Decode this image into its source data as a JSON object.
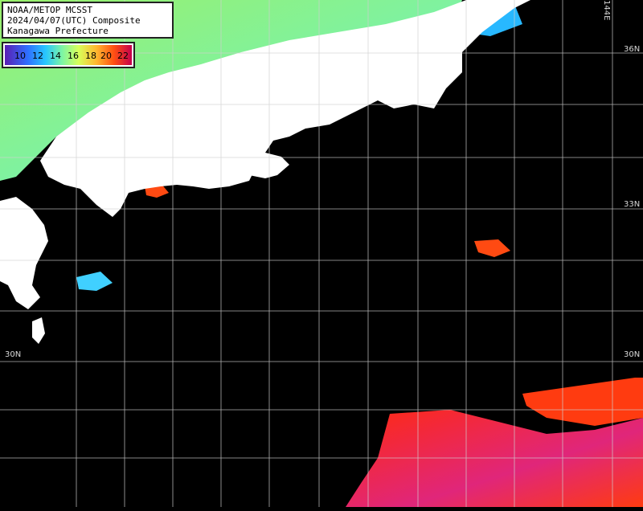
{
  "title_lines": [
    "NOAA/METOP MCSST",
    "2024/04/07(UTC) Composite",
    "Kanagawa Prefecture"
  ],
  "legend": {
    "labels": [
      "10",
      "12",
      "14",
      "16",
      "18",
      "20",
      "22"
    ],
    "colors": [
      "#5a1fb3",
      "#2f6fff",
      "#27c6ff",
      "#7cf5a5",
      "#d8ff5a",
      "#ffb830",
      "#ff4f12",
      "#c5004d"
    ]
  },
  "grid_labels": {
    "lat_36": "36N",
    "lat_33": "33N",
    "lat_30_left": "30N",
    "lat_30_right": "30N",
    "lon_144": "144E"
  },
  "map_colors": {
    "land": "#ffffff",
    "no_data": "#000000",
    "grid": "#d0d0d0",
    "cool_water": "#7ff2a0",
    "warm_water": "#ff3b10",
    "hot_water": "#e0267a"
  }
}
